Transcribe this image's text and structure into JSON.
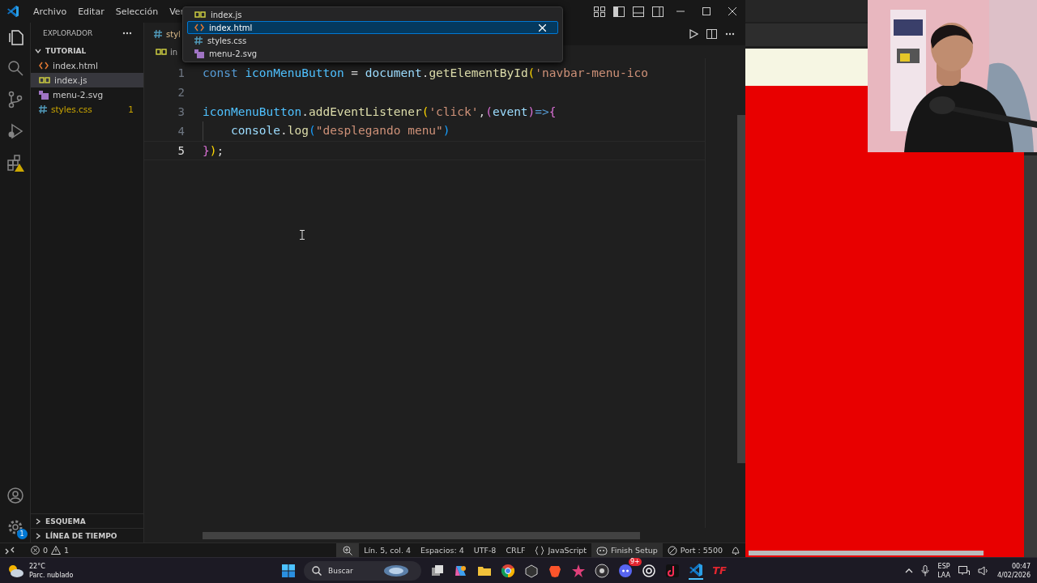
{
  "title_bar": {
    "menu": [
      "Archivo",
      "Editar",
      "Selección",
      "Ver"
    ]
  },
  "tabs": [
    {
      "label": "styl",
      "kind": "css"
    }
  ],
  "breadcrumb": {
    "label": "in",
    "kind": "js"
  },
  "quick_pick": {
    "items": [
      {
        "label": "index.js",
        "kind": "js",
        "selected": false
      },
      {
        "label": "index.html",
        "kind": "html",
        "selected": true
      },
      {
        "label": "styles.css",
        "kind": "css",
        "selected": false
      },
      {
        "label": "menu-2.svg",
        "kind": "svg",
        "selected": false
      }
    ]
  },
  "sidebar": {
    "title": "EXPLORADOR",
    "folder": {
      "label": "TUTORIAL",
      "expanded": true,
      "children": [
        {
          "label": "index.html",
          "kind": "html",
          "selected": false
        },
        {
          "label": "index.js",
          "kind": "js",
          "selected": true
        },
        {
          "label": "menu-2.svg",
          "kind": "svg",
          "selected": false
        },
        {
          "label": "styles.css",
          "kind": "css",
          "selected": false,
          "problems": "1"
        }
      ]
    },
    "panels": [
      {
        "label": "ESQUEMA",
        "expanded": false
      },
      {
        "label": "LÍNEA DE TIEMPO",
        "expanded": false
      }
    ]
  },
  "activity_bar": {
    "settings_badge": "1"
  },
  "editor": {
    "lines": [
      {
        "number": "1",
        "current": false,
        "tokens": [
          {
            "text": "const ",
            "kind": "keyword"
          },
          {
            "text": "iconMenuButton",
            "kind": "constant"
          },
          {
            "text": " = ",
            "kind": "plain"
          },
          {
            "text": "document",
            "kind": "variable"
          },
          {
            "text": ".",
            "kind": "plain"
          },
          {
            "text": "getElementById",
            "kind": "function"
          },
          {
            "text": "(",
            "kind": "bracket1"
          },
          {
            "text": "'navbar-menu-ico",
            "kind": "string"
          }
        ]
      },
      {
        "number": "2",
        "current": false
      },
      {
        "number": "3",
        "current": false,
        "tokens": [
          {
            "text": "iconMenuButton",
            "kind": "constant"
          },
          {
            "text": ".",
            "kind": "plain"
          },
          {
            "text": "addEventListener",
            "kind": "function"
          },
          {
            "text": "(",
            "kind": "bracket1"
          },
          {
            "text": "'click'",
            "kind": "string"
          },
          {
            "text": ",",
            "kind": "plain"
          },
          {
            "text": "(",
            "kind": "bracket2"
          },
          {
            "text": "event",
            "kind": "variable"
          },
          {
            "text": ")",
            "kind": "bracket2"
          },
          {
            "text": "=>",
            "kind": "keyword"
          },
          {
            "text": "{",
            "kind": "bracket2"
          }
        ]
      },
      {
        "number": "4",
        "current": false,
        "tokens": [
          {
            "kind": "indent"
          },
          {
            "text": "console",
            "kind": "variable"
          },
          {
            "text": ".",
            "kind": "plain"
          },
          {
            "text": "log",
            "kind": "function"
          },
          {
            "text": "(",
            "kind": "bracket3"
          },
          {
            "text": "\"desplegando menu\"",
            "kind": "string"
          },
          {
            "text": ")",
            "kind": "bracket3"
          }
        ]
      },
      {
        "number": "5",
        "current": true,
        "tokens": [
          {
            "text": "}",
            "kind": "bracket2"
          },
          {
            "text": ")",
            "kind": "bracket1"
          },
          {
            "text": ";",
            "kind": "plain"
          }
        ]
      }
    ]
  },
  "status_bar": {
    "errors": "0",
    "warnings": "1",
    "items": [
      "Lín. 5, col. 4",
      "Espacios: 4",
      "UTF-8",
      "CRLF"
    ],
    "language": "JavaScript",
    "copilot": "Finish Setup",
    "port": "Port : 5500"
  },
  "taskbar": {
    "weather": {
      "temperature": "22°C",
      "condition": "Parc. nublado"
    },
    "search": {
      "placeholder": "Buscar"
    },
    "apps": [
      {
        "kind": "files",
        "active": false
      },
      {
        "kind": "copilot",
        "active": false
      },
      {
        "kind": "folder",
        "active": false
      },
      {
        "kind": "chrome",
        "active": false
      },
      {
        "kind": "cube",
        "active": false
      },
      {
        "kind": "brave",
        "active": false
      },
      {
        "kind": "star",
        "active": false
      },
      {
        "kind": "obs",
        "active": false
      },
      {
        "kind": "discord",
        "badge": "9+",
        "active": false
      },
      {
        "kind": "chatgpt",
        "active": false
      },
      {
        "kind": "tiktok",
        "active": false
      },
      {
        "kind": "vscode",
        "active": true
      },
      {
        "kind": "tf",
        "label": "TF",
        "active": false
      }
    ],
    "tray": {
      "language": "ESP",
      "layout": "LAA",
      "time": "00:47",
      "date": "4/02/2026"
    }
  }
}
